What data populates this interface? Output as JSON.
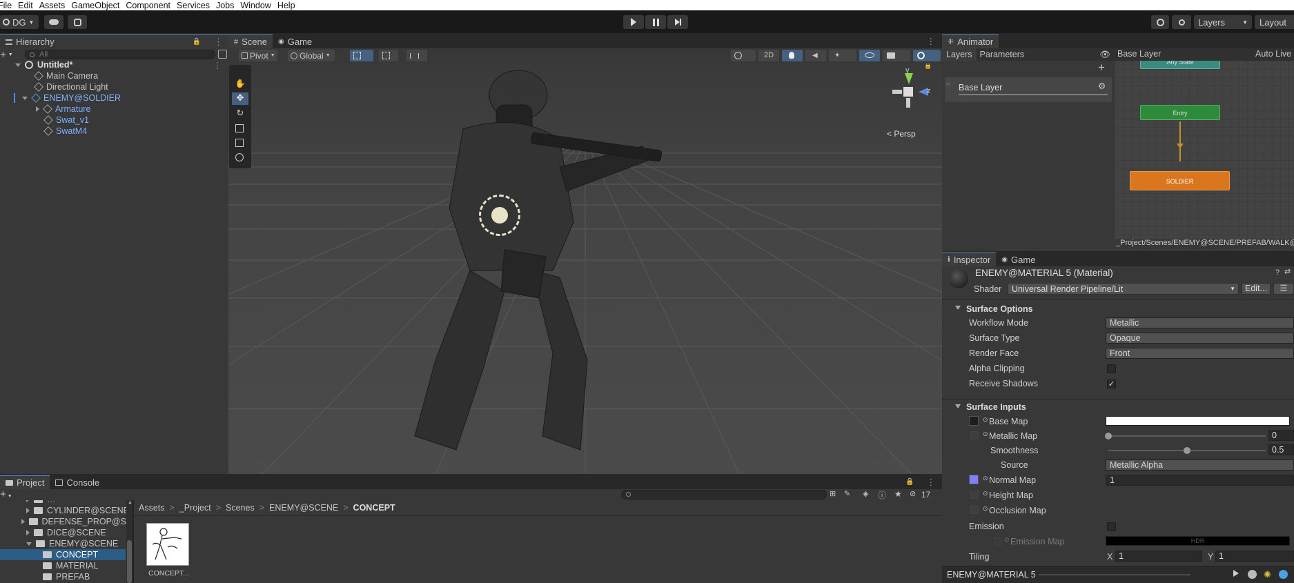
{
  "menu": [
    "File",
    "Edit",
    "Assets",
    "GameObject",
    "Component",
    "Services",
    "Jobs",
    "Window",
    "Help"
  ],
  "toolbar": {
    "account": "DG",
    "layers": "Layers",
    "layout": "Layout"
  },
  "hierarchy": {
    "tab": "Hierarchy",
    "search_placeholder": "All",
    "scene": "Untitled*",
    "items": [
      "Main Camera",
      "Directional Light",
      "ENEMY@SOLDIER",
      "Armature",
      "Swat_v1",
      "SwatM4"
    ]
  },
  "scene": {
    "tabs": [
      "Scene",
      "Game"
    ],
    "pivot": "Pivot",
    "global": "Global",
    "mode2d": "2D",
    "persp": "< Persp",
    "axis_y": "y",
    "axis_z": "z"
  },
  "animator": {
    "tab": "Animator",
    "subtabs": [
      "Layers",
      "Parameters"
    ],
    "breadcrumb": "Base Layer",
    "auto_live": "Auto Live",
    "layer_name": "Base Layer",
    "states": {
      "any": "Any State",
      "entry": "Entry",
      "soldier": "SOLDIER"
    },
    "path": "_Project/Scenes/ENEMY@SCENE/PREFAB/WALK@EN"
  },
  "inspector": {
    "tabs": [
      "Inspector",
      "Game"
    ],
    "material_name": "ENEMY@MATERIAL 5 (Material)",
    "shader_label": "Shader",
    "shader_value": "Universal Render Pipeline/Lit",
    "edit_button": "Edit...",
    "surface_options": "Surface Options",
    "workflow_label": "Workflow Mode",
    "workflow_value": "Metallic",
    "surface_type_label": "Surface Type",
    "surface_type_value": "Opaque",
    "render_face_label": "Render Face",
    "render_face_value": "Front",
    "alpha_clip_label": "Alpha Clipping",
    "receive_shadows_label": "Receive Shadows",
    "surface_inputs": "Surface Inputs",
    "base_map": "Base Map",
    "metallic_map": "Metallic Map",
    "metallic_value": "0",
    "smoothness": "Smoothness",
    "smoothness_value": "0.5",
    "source_label": "Source",
    "source_value": "Metallic Alpha",
    "normal_map": "Normal Map",
    "normal_value": "1",
    "height_map": "Height Map",
    "occlusion_map": "Occlusion Map",
    "emission": "Emission",
    "emission_map": "Emission Map",
    "hdr": "HDR",
    "tiling": "Tiling",
    "tiling_x_label": "X",
    "tiling_x": "1",
    "tiling_y_label": "Y",
    "tiling_y": "1",
    "footer": "ENEMY@MATERIAL 5",
    "metallic_fraction": 0,
    "smoothness_fraction": 0.5,
    "colors": {
      "base_map": "#ffffff",
      "normal_swatch": "#8080ff",
      "emission": "#000000"
    }
  },
  "project": {
    "tabs": [
      "Project",
      "Console"
    ],
    "count": "17",
    "folders": [
      "DEFENSE_PROP@SC",
      "DICE@SCENE",
      "ENEMY@SCENE",
      "CONCEPT",
      "MATERIAL",
      "PREFAB"
    ],
    "folder_top_partial": "CYLINDER@SCENE",
    "breadcrumb": [
      "Assets",
      "_Project",
      "Scenes",
      "ENEMY@SCENE",
      "CONCEPT"
    ],
    "asset_name": "CONCEPT..."
  }
}
